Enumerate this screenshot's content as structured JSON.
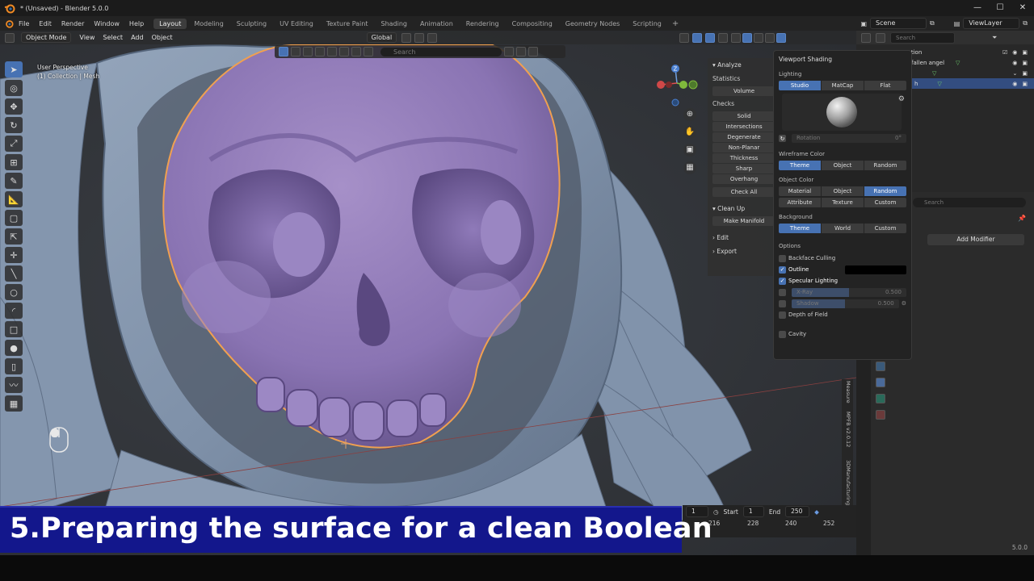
{
  "window": {
    "title": "* (Unsaved) - Blender 5.0.0",
    "controls": [
      "—",
      "☐",
      "✕"
    ]
  },
  "menubar": {
    "menus": [
      "File",
      "Edit",
      "Render",
      "Window",
      "Help"
    ],
    "workspaces": [
      "Layout",
      "Modeling",
      "Sculpting",
      "UV Editing",
      "Texture Paint",
      "Shading",
      "Animation",
      "Rendering",
      "Compositing",
      "Geometry Nodes",
      "Scripting"
    ],
    "active_workspace": "Layout",
    "scene": "Scene",
    "view_layer": "ViewLayer"
  },
  "viewport_header": {
    "mode": "Object Mode",
    "menus": [
      "View",
      "Select",
      "Add",
      "Object"
    ],
    "orientation": "Global",
    "search_placeholder": "Search"
  },
  "viewport_overlay": {
    "perspective": "User Perspective",
    "collection": "(1) Collection | Mesh"
  },
  "analyze_panel": {
    "header": "Analyze",
    "statistics": "Statistics",
    "volume_btn": "Volume",
    "checks": "Checks",
    "check_btns": [
      "Solid",
      "Intersections",
      "Degenerate",
      "Non-Planar",
      "Thickness",
      "Sharp",
      "Overhang",
      "Check All"
    ],
    "cleanup": "Clean Up",
    "make_manifold": "Make Manifold",
    "edit": "Edit",
    "export": "Export"
  },
  "shading_popover": {
    "title": "Viewport Shading",
    "lighting_label": "Lighting",
    "lighting": [
      "Studio",
      "MatCap",
      "Flat"
    ],
    "lighting_active": "Studio",
    "rotation_label": "Rotation",
    "rotation_value": "0°",
    "wireframe_label": "Wireframe Color",
    "wireframe": [
      "Theme",
      "Object",
      "Random"
    ],
    "wireframe_active": "Theme",
    "object_color_label": "Object Color",
    "object_color_row1": [
      "Material",
      "Object",
      "Random"
    ],
    "object_color_row2": [
      "Attribute",
      "Texture",
      "Custom"
    ],
    "object_color_active": "Random",
    "background_label": "Background",
    "background": [
      "Theme",
      "World",
      "Custom"
    ],
    "background_active": "Theme",
    "options_label": "Options",
    "backface_culling": "Backface Culling",
    "outline": "Outline",
    "outline_checked": true,
    "specular": "Specular Lighting",
    "specular_checked": true,
    "xray_label": "X-Ray",
    "xray_value": "0.500",
    "xray_level": 0.5,
    "shadow_label": "Shadow",
    "shadow_value": "0.500",
    "shadow_level": 0.5,
    "depth_of_field": "Depth of Field",
    "cavity": "Cavity"
  },
  "outliner": {
    "search_placeholder": "Search",
    "rows": [
      "ction",
      "fallen angel",
      "",
      "h"
    ]
  },
  "properties": {
    "search_placeholder": "Search",
    "add_modifier": "Add Modifier"
  },
  "side_tabs": [
    "Measure",
    "MPFB v2.0.12",
    "3DManufacturing"
  ],
  "timeline": {
    "current_frame": "1",
    "start_label": "Start",
    "start": "1",
    "end_label": "End",
    "end": "250",
    "ticks": [
      "216",
      "228",
      "240",
      "252"
    ]
  },
  "caption": "5.Preparing the surface for a clean Boolean",
  "version": "5.0.0"
}
